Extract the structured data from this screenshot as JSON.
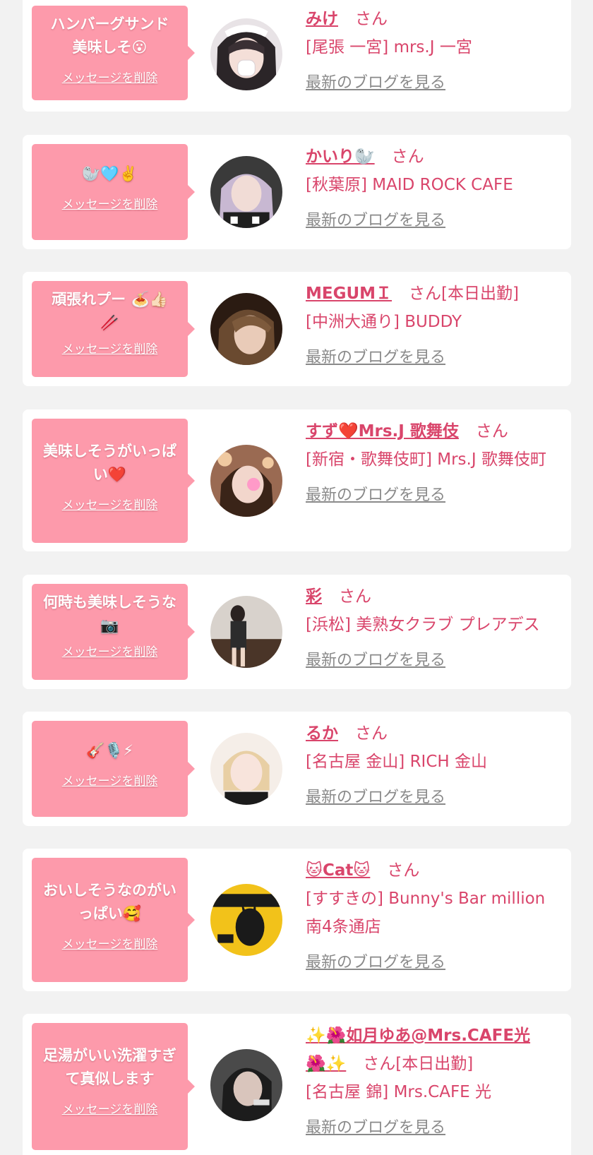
{
  "common": {
    "delete_label": "メッセージを削除",
    "blog_label": "最新のブログを見る",
    "honorific": "さん"
  },
  "items": [
    {
      "message": "ハンバーグサンド美味しそ😮",
      "name": "みけ",
      "status": "",
      "shop": "[尾張 一宮] mrs.J 一宮",
      "avatar_icon": "cast-photo"
    },
    {
      "message": "🦭🩵✌️",
      "name": "かいり🦭",
      "status": "",
      "shop": "[秋葉原] MAID ROCK CAFE",
      "avatar_icon": "cast-photo"
    },
    {
      "message": "頑張れプー 🍝👍🏻 🥢",
      "name": "MEGUMＩ",
      "status": "[本日出勤]",
      "shop": "[中洲大通り] BUDDY",
      "avatar_icon": "cast-photo"
    },
    {
      "message": "美味しそうがいっぱい❤️",
      "name": "すず❤️Mrs.J 歌舞伎",
      "status": "",
      "shop": "[新宿・歌舞伎町] Mrs.J 歌舞伎町",
      "avatar_icon": "cast-photo"
    },
    {
      "message": "何時も美味しそうな📷",
      "name": "彩",
      "status": "",
      "shop": "[浜松] 美熟女クラブ プレアデス",
      "avatar_icon": "cast-photo"
    },
    {
      "message": "🎸🎙️⚡",
      "name": "るか",
      "status": "",
      "shop": "[名古屋 金山] RICH 金山",
      "avatar_icon": "cast-photo"
    },
    {
      "message": "おいしそうなのがいっぱい🥰",
      "name": "🐱Cat🐱",
      "status": "",
      "shop": "[すすきの] Bunny's Bar million 南4条通店",
      "avatar_icon": "cast-photo"
    },
    {
      "message": "足湯がいい洗濯すぎて真似します",
      "name": "✨🌺如月ゆあ@Mrs.CAFE光🌺✨",
      "status": "[本日出勤]",
      "shop": "[名古屋 錦] Mrs.CAFE 光",
      "avatar_icon": "cast-photo"
    }
  ],
  "colors": {
    "page_bg": "#f2f2f2",
    "card_bg": "#ffffff",
    "bubble_bg": "#fd9aab",
    "accent": "#d9456b",
    "link_gray": "#8a8a8a"
  }
}
